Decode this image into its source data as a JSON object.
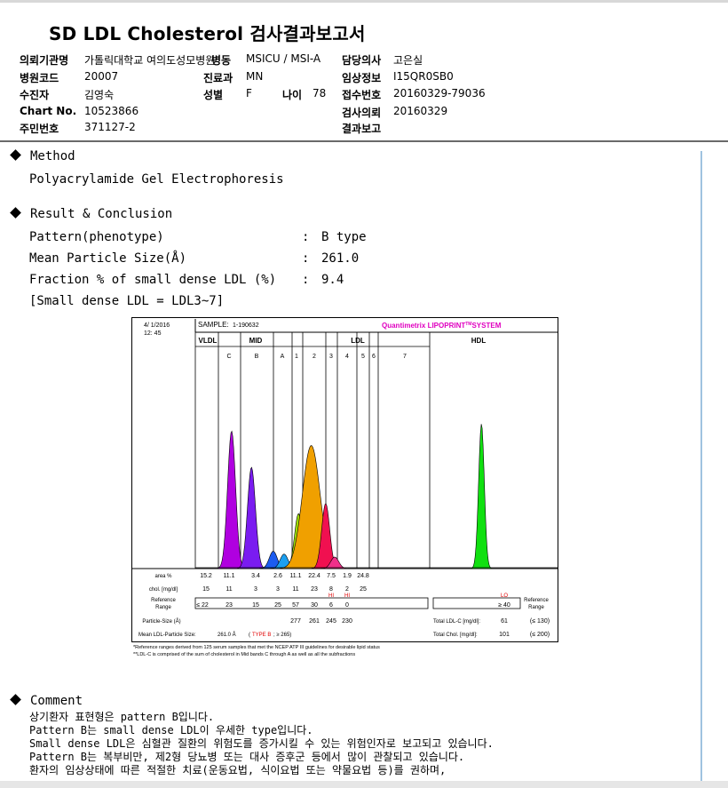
{
  "report": {
    "title": "SD LDL Cholesterol 검사결과보고서",
    "fields": {
      "institution": {
        "label": "의뢰기관명",
        "value": "가톨릭대학교 여의도성모병원"
      },
      "ward_label": "병동",
      "ward_value": "MSICU / MSI-A",
      "doctor": {
        "label": "담당의사",
        "value": "고은실"
      },
      "hospital_code": {
        "label": "병원코드",
        "value": "20007"
      },
      "department": {
        "label": "진료과",
        "value": "MN"
      },
      "clinical_info": {
        "label": "임상정보",
        "value": "I15QR0SB0"
      },
      "patient": {
        "label": "수진자",
        "value": "김영숙"
      },
      "sex": {
        "label": "성별",
        "value": "F"
      },
      "age": {
        "label": "나이",
        "value": "78"
      },
      "receipt_no": {
        "label": "접수번호",
        "value": "20160329-79036"
      },
      "chart_no": {
        "label": "Chart No.",
        "value": "10523866"
      },
      "request_date": {
        "label": "검사의뢰",
        "value": "20160329"
      },
      "resident_no": {
        "label": "주민번호",
        "value": "371127-2"
      },
      "result_report": {
        "label": "결과보고",
        "value": ""
      }
    }
  },
  "method": {
    "heading": "Method",
    "text": "Polyacrylamide Gel Electrophoresis"
  },
  "result": {
    "heading": "Result & Conclusion",
    "rows": [
      {
        "label": "Pattern(phenotype)",
        "sep": ":",
        "value": "B type"
      },
      {
        "label": "Mean Particle Size(Å)",
        "sep": ":",
        "value": "261.0"
      },
      {
        "label": "Fraction % of small dense LDL (%)",
        "sep": ":",
        "value": "9.4"
      }
    ],
    "note": "[Small dense LDL = LDL3~7]"
  },
  "chart_data": {
    "type": "area",
    "date": "4/ 1/2016",
    "time": "12: 45",
    "sample_label": "SAMPLE:",
    "sample_value": "1-190632",
    "brand_main": "Quantimetrix LIPOPRINT",
    "brand_tm": "TM",
    "brand_tail": "SYSTEM",
    "group_labels": [
      "VLDL",
      "MID",
      "LDL",
      "HDL"
    ],
    "band_labels": [
      "C",
      "B",
      "A",
      "1",
      "2",
      "3",
      "4",
      "5",
      "6",
      "7"
    ],
    "area_label": "area %",
    "area_values": [
      "15.2",
      "11.1",
      "3.4",
      "2.6",
      "11.1",
      "22.4",
      "7.5",
      "1.9",
      "24.8"
    ],
    "chol_label": "chol. [mg/dl]",
    "chol_values": [
      "15",
      "11",
      "3",
      "3",
      "11",
      "23",
      "8",
      "2",
      "25"
    ],
    "chol_flags": [
      "HI",
      "HI",
      "LO"
    ],
    "ref_label_1": "Reference",
    "ref_label_2": "Range",
    "ref_values": [
      "≤ 22",
      "23",
      "15",
      "25",
      "57",
      "30",
      "6",
      "0",
      "≥ 40"
    ],
    "particle_size_label": "Particle-Size (Å)",
    "particle_size_values": [
      "277",
      "261",
      "245",
      "230"
    ],
    "total_ldl_label": "Total LDL-C [mg/dl]:",
    "total_ldl_value": "61",
    "total_ldl_ref": "(≤ 130)",
    "total_chol_label": "Total Chol. [mg/dl]:",
    "total_chol_value": "101",
    "total_chol_ref": "(≤ 200)",
    "mean_ldl_label": "Mean LDL-Particle Size:",
    "mean_ldl_value": "261.0 Å",
    "mean_ldl_type": "TYPE B",
    "mean_ldl_ref": "; ≥ 265)",
    "footnote_1": "*Reference ranges derived from 125 serum samples that met the NCEP ATP III guidelines for desirable lipid status",
    "footnote_2": "**LDL-C is comprised of the sum of cholesterol in Mid bands C through A as well as all the subfractions",
    "peaks": [
      {
        "name": "VLDL",
        "x": 0.1,
        "height": 0.95,
        "color": "#b000e0"
      },
      {
        "name": "MID-C",
        "x": 0.155,
        "height": 0.7,
        "color": "#7a1cf0"
      },
      {
        "name": "MID-B",
        "x": 0.215,
        "height": 0.12,
        "color": "#1c5cf0"
      },
      {
        "name": "MID-A",
        "x": 0.245,
        "height": 0.1,
        "color": "#1c9ff0"
      },
      {
        "name": "LDL1",
        "x": 0.285,
        "height": 0.38,
        "color": "#a0e000"
      },
      {
        "name": "LDL2",
        "x": 0.32,
        "height": 0.85,
        "color": "#f0a000"
      },
      {
        "name": "LDL3",
        "x": 0.36,
        "height": 0.45,
        "color": "#f01050"
      },
      {
        "name": "LDL4",
        "x": 0.385,
        "height": 0.08,
        "color": "#f0308a"
      },
      {
        "name": "HDL",
        "x": 0.79,
        "height": 1.0,
        "color": "#10e010"
      }
    ],
    "colors": {
      "vldl": "#b000e0",
      "mid": "#1c5cf0",
      "ldl": "#f0a000",
      "hdl": "#10e010",
      "brand": "#e000c0",
      "flag": "#e00000"
    }
  },
  "comment": {
    "heading": "Comment",
    "lines": [
      "상기환자 표현형은 pattern B입니다.",
      "Pattern B는 small dense LDL이 우세한 type입니다.",
      "Small dense LDL은 심혈관 질환의 위험도를 증가시킬 수 있는 위험인자로 보고되고 있습니다.",
      "Pattern B는 복부비만, 제2형 당뇨병 또는 대사 증후군 등에서 많이 관찰되고 있습니다.",
      "환자의 임상상태에 따른 적절한 치료(운동요법, 식이요법 또는 약물요법 등)를 권하며,"
    ]
  }
}
